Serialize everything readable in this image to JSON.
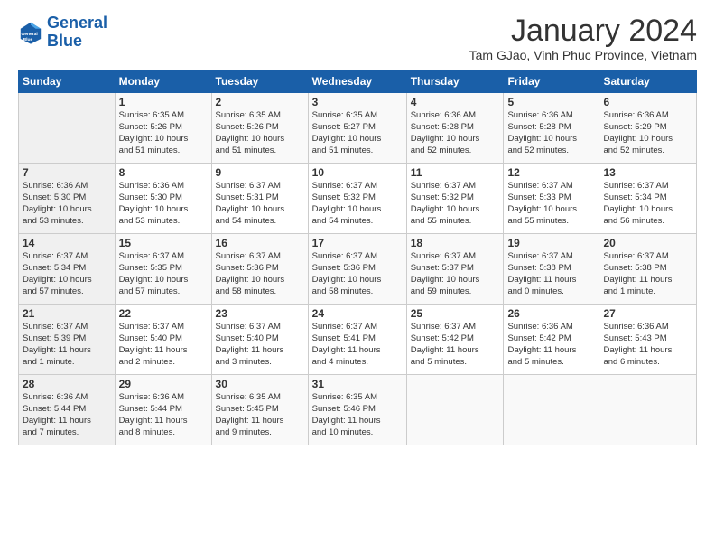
{
  "logo": {
    "line1": "General",
    "line2": "Blue"
  },
  "title": "January 2024",
  "subtitle": "Tam GJao, Vinh Phuc Province, Vietnam",
  "days_header": [
    "Sunday",
    "Monday",
    "Tuesday",
    "Wednesday",
    "Thursday",
    "Friday",
    "Saturday"
  ],
  "weeks": [
    [
      {
        "day": "",
        "text": ""
      },
      {
        "day": "1",
        "text": "Sunrise: 6:35 AM\nSunset: 5:26 PM\nDaylight: 10 hours\nand 51 minutes."
      },
      {
        "day": "2",
        "text": "Sunrise: 6:35 AM\nSunset: 5:26 PM\nDaylight: 10 hours\nand 51 minutes."
      },
      {
        "day": "3",
        "text": "Sunrise: 6:35 AM\nSunset: 5:27 PM\nDaylight: 10 hours\nand 51 minutes."
      },
      {
        "day": "4",
        "text": "Sunrise: 6:36 AM\nSunset: 5:28 PM\nDaylight: 10 hours\nand 52 minutes."
      },
      {
        "day": "5",
        "text": "Sunrise: 6:36 AM\nSunset: 5:28 PM\nDaylight: 10 hours\nand 52 minutes."
      },
      {
        "day": "6",
        "text": "Sunrise: 6:36 AM\nSunset: 5:29 PM\nDaylight: 10 hours\nand 52 minutes."
      }
    ],
    [
      {
        "day": "7",
        "text": "Sunrise: 6:36 AM\nSunset: 5:30 PM\nDaylight: 10 hours\nand 53 minutes."
      },
      {
        "day": "8",
        "text": "Sunrise: 6:36 AM\nSunset: 5:30 PM\nDaylight: 10 hours\nand 53 minutes."
      },
      {
        "day": "9",
        "text": "Sunrise: 6:37 AM\nSunset: 5:31 PM\nDaylight: 10 hours\nand 54 minutes."
      },
      {
        "day": "10",
        "text": "Sunrise: 6:37 AM\nSunset: 5:32 PM\nDaylight: 10 hours\nand 54 minutes."
      },
      {
        "day": "11",
        "text": "Sunrise: 6:37 AM\nSunset: 5:32 PM\nDaylight: 10 hours\nand 55 minutes."
      },
      {
        "day": "12",
        "text": "Sunrise: 6:37 AM\nSunset: 5:33 PM\nDaylight: 10 hours\nand 55 minutes."
      },
      {
        "day": "13",
        "text": "Sunrise: 6:37 AM\nSunset: 5:34 PM\nDaylight: 10 hours\nand 56 minutes."
      }
    ],
    [
      {
        "day": "14",
        "text": "Sunrise: 6:37 AM\nSunset: 5:34 PM\nDaylight: 10 hours\nand 57 minutes."
      },
      {
        "day": "15",
        "text": "Sunrise: 6:37 AM\nSunset: 5:35 PM\nDaylight: 10 hours\nand 57 minutes."
      },
      {
        "day": "16",
        "text": "Sunrise: 6:37 AM\nSunset: 5:36 PM\nDaylight: 10 hours\nand 58 minutes."
      },
      {
        "day": "17",
        "text": "Sunrise: 6:37 AM\nSunset: 5:36 PM\nDaylight: 10 hours\nand 58 minutes."
      },
      {
        "day": "18",
        "text": "Sunrise: 6:37 AM\nSunset: 5:37 PM\nDaylight: 10 hours\nand 59 minutes."
      },
      {
        "day": "19",
        "text": "Sunrise: 6:37 AM\nSunset: 5:38 PM\nDaylight: 11 hours\nand 0 minutes."
      },
      {
        "day": "20",
        "text": "Sunrise: 6:37 AM\nSunset: 5:38 PM\nDaylight: 11 hours\nand 1 minute."
      }
    ],
    [
      {
        "day": "21",
        "text": "Sunrise: 6:37 AM\nSunset: 5:39 PM\nDaylight: 11 hours\nand 1 minute."
      },
      {
        "day": "22",
        "text": "Sunrise: 6:37 AM\nSunset: 5:40 PM\nDaylight: 11 hours\nand 2 minutes."
      },
      {
        "day": "23",
        "text": "Sunrise: 6:37 AM\nSunset: 5:40 PM\nDaylight: 11 hours\nand 3 minutes."
      },
      {
        "day": "24",
        "text": "Sunrise: 6:37 AM\nSunset: 5:41 PM\nDaylight: 11 hours\nand 4 minutes."
      },
      {
        "day": "25",
        "text": "Sunrise: 6:37 AM\nSunset: 5:42 PM\nDaylight: 11 hours\nand 5 minutes."
      },
      {
        "day": "26",
        "text": "Sunrise: 6:36 AM\nSunset: 5:42 PM\nDaylight: 11 hours\nand 5 minutes."
      },
      {
        "day": "27",
        "text": "Sunrise: 6:36 AM\nSunset: 5:43 PM\nDaylight: 11 hours\nand 6 minutes."
      }
    ],
    [
      {
        "day": "28",
        "text": "Sunrise: 6:36 AM\nSunset: 5:44 PM\nDaylight: 11 hours\nand 7 minutes."
      },
      {
        "day": "29",
        "text": "Sunrise: 6:36 AM\nSunset: 5:44 PM\nDaylight: 11 hours\nand 8 minutes."
      },
      {
        "day": "30",
        "text": "Sunrise: 6:35 AM\nSunset: 5:45 PM\nDaylight: 11 hours\nand 9 minutes."
      },
      {
        "day": "31",
        "text": "Sunrise: 6:35 AM\nSunset: 5:46 PM\nDaylight: 11 hours\nand 10 minutes."
      },
      {
        "day": "",
        "text": ""
      },
      {
        "day": "",
        "text": ""
      },
      {
        "day": "",
        "text": ""
      }
    ]
  ]
}
